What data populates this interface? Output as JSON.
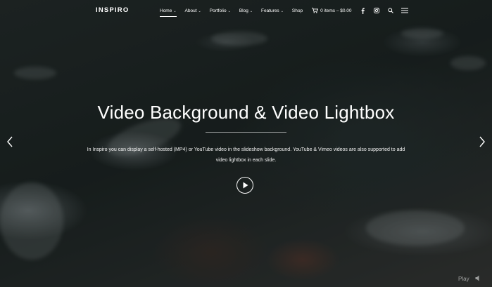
{
  "header": {
    "logo": "INSPIRO",
    "nav": [
      {
        "label": "Home",
        "caret": "⌄",
        "active": true
      },
      {
        "label": "About",
        "caret": "⌄"
      },
      {
        "label": "Portfolio",
        "caret": "⌄"
      },
      {
        "label": "Blog",
        "caret": "⌄"
      },
      {
        "label": "Features",
        "caret": "⌄"
      },
      {
        "label": "Shop",
        "caret": ""
      }
    ],
    "cart_label": "0 items – $0.00",
    "icons": [
      "cart-icon",
      "facebook-icon",
      "instagram-icon",
      "search-icon",
      "menu-icon"
    ]
  },
  "slide": {
    "title": "Video Background & Video Lightbox",
    "description_line1": "In Inspiro you can display a self-hosted (MP4) or YouTube video in the slideshow background. YouTube & Vimeo videos are also supported to add",
    "description_line2": "video lightbox in each slide."
  },
  "controls": {
    "play_label": "Play"
  },
  "colors": {
    "text": "#ffffff",
    "overlay": "#1d2524"
  }
}
